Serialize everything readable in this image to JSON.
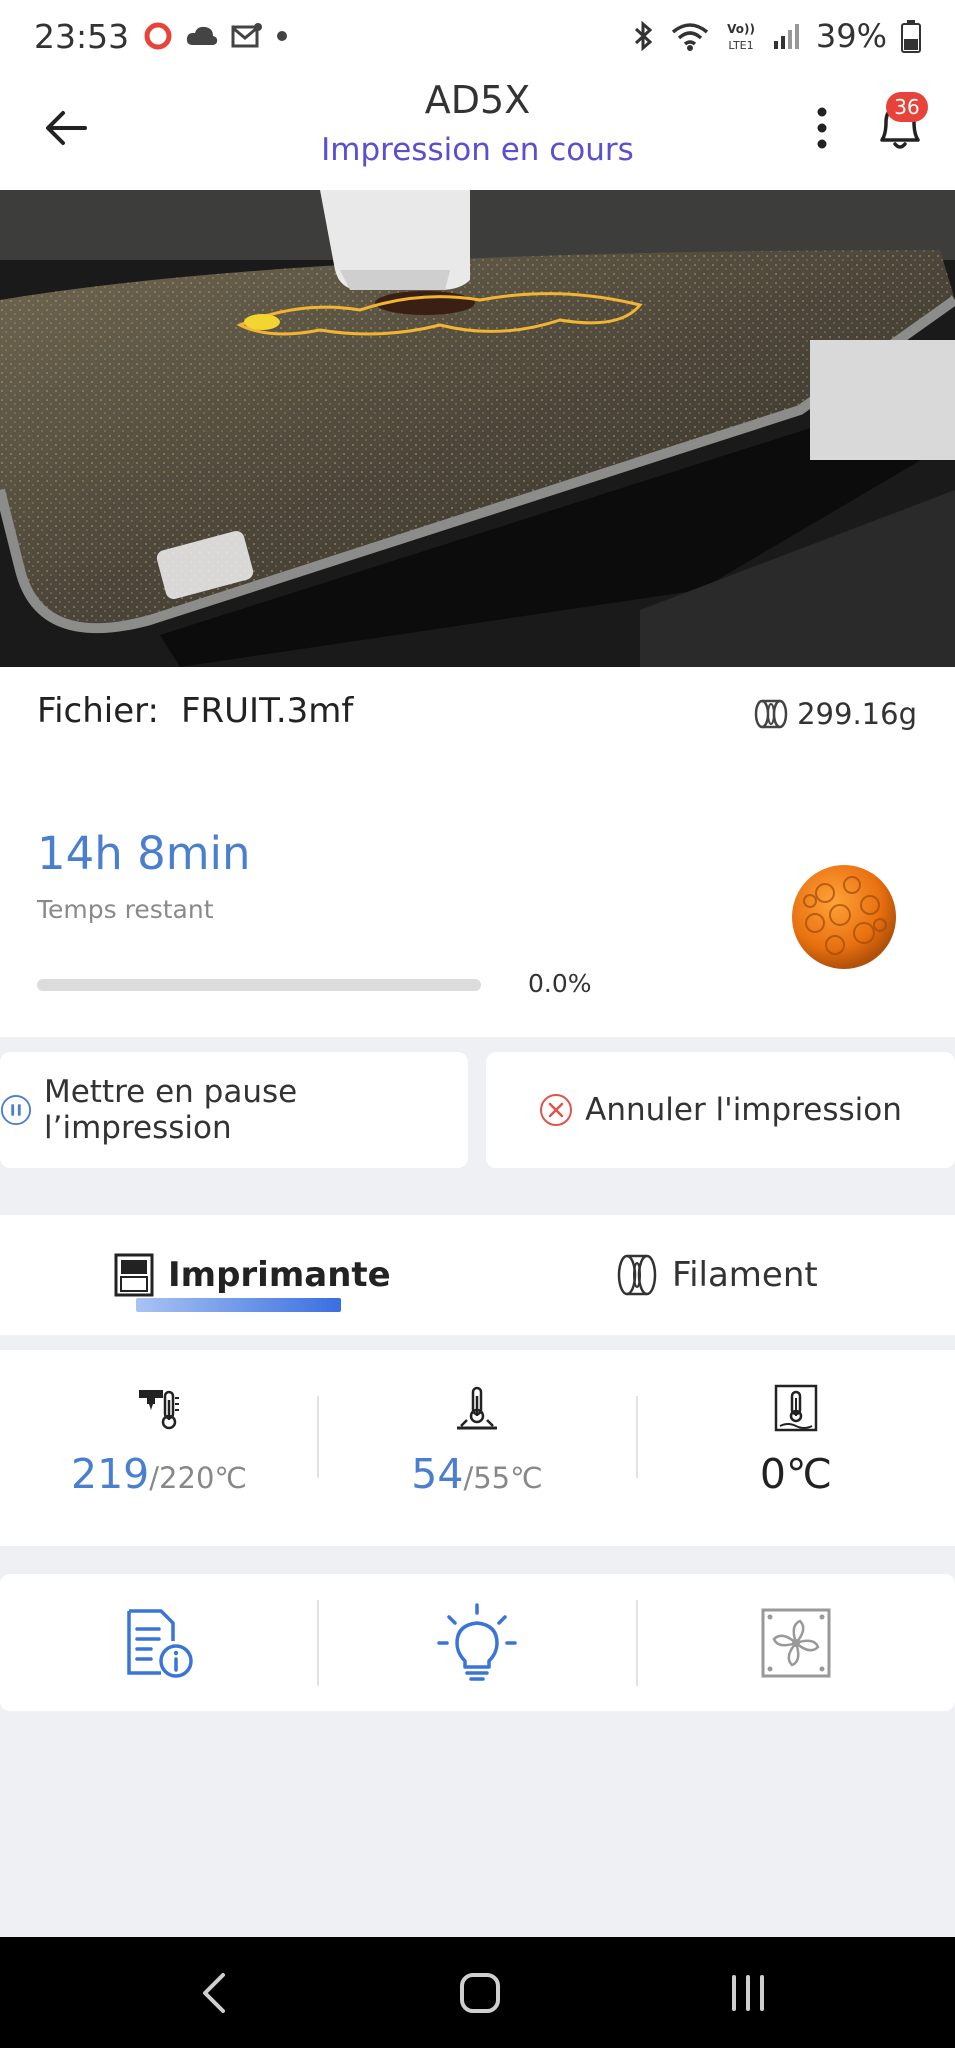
{
  "status_bar": {
    "time": "23:53",
    "battery": "39%",
    "icons": [
      "opera-icon",
      "cloud-icon",
      "mail-icon",
      "dot-icon",
      "bluetooth-icon",
      "wifi-icon",
      "volte-icon",
      "signal-icon",
      "battery-icon"
    ]
  },
  "header": {
    "title": "AD5X",
    "subtitle": "Impression en cours",
    "notification_count": "36"
  },
  "file": {
    "label": "Fichier:",
    "name": "FRUIT.3mf",
    "weight": "299.16g"
  },
  "progress": {
    "time_remaining": "14h 8min",
    "time_label": "Temps restant",
    "percent_text": "0.0%",
    "percent_value": 0.0
  },
  "actions": {
    "pause_label": "Mettre en pause l’impression",
    "cancel_label": "Annuler l'impression"
  },
  "tabs": [
    {
      "label": "Imprimante",
      "active": true
    },
    {
      "label": "Filament",
      "active": false
    }
  ],
  "temps": {
    "nozzle_current": "219",
    "nozzle_target": "/220℃",
    "bed_current": "54",
    "bed_target": "/55℃",
    "chamber": "0℃"
  },
  "controls": [
    "file-info-icon",
    "light-icon",
    "fan-icon"
  ],
  "colors": {
    "accent_blue": "#4a7fd0",
    "subtitle_purple": "#5a4fcf",
    "badge_red": "#e8433a",
    "cancel_red": "#e0534a"
  }
}
